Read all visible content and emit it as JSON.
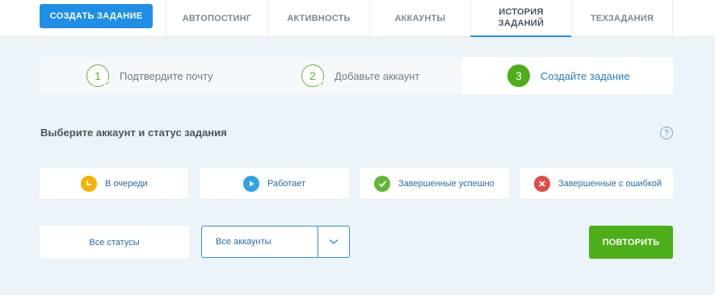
{
  "topbar": {
    "create_label": "СОЗДАТЬ ЗАДАНИЕ",
    "tabs": [
      {
        "label": "АВТОПОСТИНГ"
      },
      {
        "label": "АКТИВНОСТЬ"
      },
      {
        "label": "АККАУНТЫ"
      },
      {
        "label": "ИСТОРИЯ\nЗАДАНИЙ",
        "active": true
      },
      {
        "label": "ТЕХЗАДАНИЯ"
      }
    ]
  },
  "steps": [
    {
      "number": "1",
      "label": "Подтвердите почту",
      "done": true
    },
    {
      "number": "2",
      "label": "Добавьте аккаунт",
      "done": true
    },
    {
      "number": "3",
      "label": "Создайте задание",
      "active": true
    }
  ],
  "section": {
    "title": "Выберите аккаунт и статус задания",
    "help_icon": "?"
  },
  "status_cards": [
    {
      "label": "В очереди",
      "icon": "clock-icon",
      "color": "#f4b400"
    },
    {
      "label": "Работает",
      "icon": "play-icon",
      "color": "#2ea3e8"
    },
    {
      "label": "Завершенные успешно",
      "icon": "check-icon",
      "color": "#5fb833"
    },
    {
      "label": "Завершенные с ошибкой",
      "icon": "close-icon",
      "color": "#e04b4b"
    }
  ],
  "filters": {
    "status_value": "Все статусы",
    "account_value": "Все аккаунты"
  },
  "repeat_label": "ПОВТОРИТЬ",
  "colors": {
    "accent_blue": "#1f8ee6",
    "success_green": "#4caf1a",
    "background": "#ecf4f9"
  }
}
